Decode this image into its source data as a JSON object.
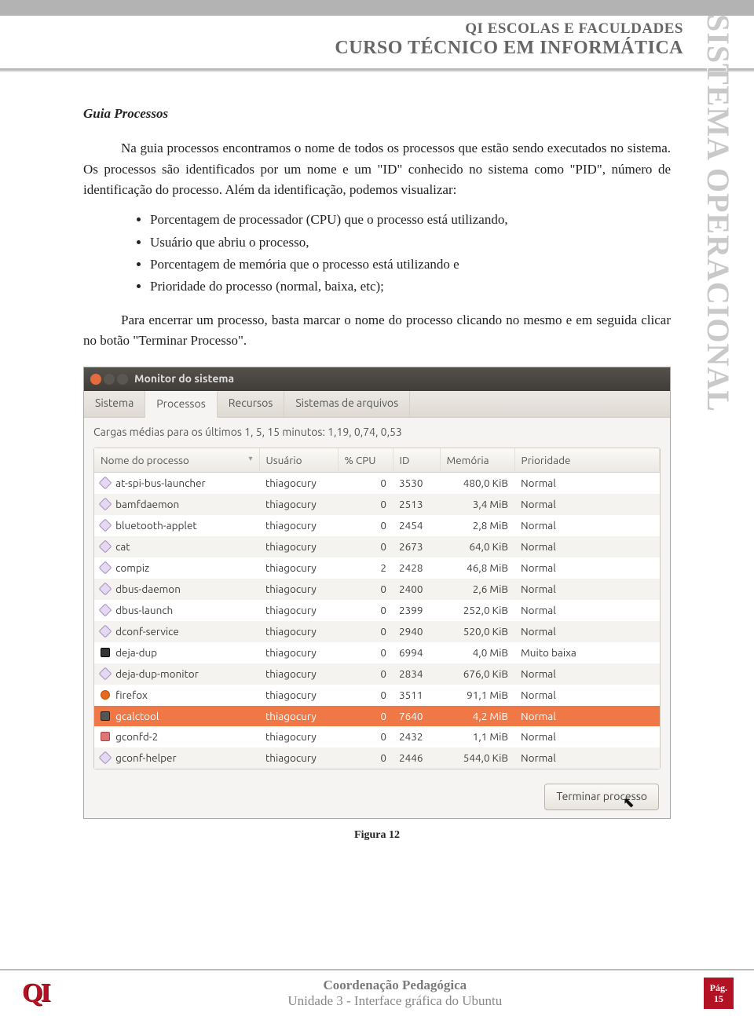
{
  "header": {
    "line1": "QI ESCOLAS E FACULDADES",
    "line2": "CURSO TÉCNICO EM INFORMÁTICA"
  },
  "side_label": "SISTEMA OPERACIONAL",
  "section_title": "Guia Processos",
  "paragraph1": "Na guia processos encontramos o nome de todos os processos que estão sendo executados no sistema. Os processos são identificados por um nome e um \"ID\" conhecido no sistema como \"PID\", número de identificação do processo. Além da identificação, podemos visualizar:",
  "bullets": [
    "Porcentagem de processador (CPU) que o processo está utilizando,",
    "Usuário que abriu o processo,",
    "Porcentagem de memória que o processo está utilizando e",
    "Prioridade do processo (normal, baixa, etc);"
  ],
  "paragraph2": "Para encerrar um processo, basta marcar o nome do processo clicando no mesmo e em seguida clicar no botão \"Terminar Processo\".",
  "screenshot": {
    "window_title": "Monitor do sistema",
    "tabs": [
      "Sistema",
      "Processos",
      "Recursos",
      "Sistemas de arquivos"
    ],
    "active_tab_index": 1,
    "loads_text": "Cargas médias para os últimos 1, 5, 15 minutos: 1,19, 0,74, 0,53",
    "columns": [
      "Nome do processo",
      "Usuário",
      "% CPU",
      "ID",
      "Memória",
      "Prioridade"
    ],
    "rows": [
      {
        "name": "at-spi-bus-launcher",
        "user": "thiagocury",
        "cpu": "0",
        "id": "3530",
        "mem": "480,0 KiB",
        "pri": "Normal",
        "icon": "diamond"
      },
      {
        "name": "bamfdaemon",
        "user": "thiagocury",
        "cpu": "0",
        "id": "2513",
        "mem": "3,4 MiB",
        "pri": "Normal",
        "icon": "diamond"
      },
      {
        "name": "bluetooth-applet",
        "user": "thiagocury",
        "cpu": "0",
        "id": "2454",
        "mem": "2,8 MiB",
        "pri": "Normal",
        "icon": "diamond"
      },
      {
        "name": "cat",
        "user": "thiagocury",
        "cpu": "0",
        "id": "2673",
        "mem": "64,0 KiB",
        "pri": "Normal",
        "icon": "diamond"
      },
      {
        "name": "compiz",
        "user": "thiagocury",
        "cpu": "2",
        "id": "2428",
        "mem": "46,8 MiB",
        "pri": "Normal",
        "icon": "diamond"
      },
      {
        "name": "dbus-daemon",
        "user": "thiagocury",
        "cpu": "0",
        "id": "2400",
        "mem": "2,6 MiB",
        "pri": "Normal",
        "icon": "diamond"
      },
      {
        "name": "dbus-launch",
        "user": "thiagocury",
        "cpu": "0",
        "id": "2399",
        "mem": "252,0 KiB",
        "pri": "Normal",
        "icon": "diamond"
      },
      {
        "name": "dconf-service",
        "user": "thiagocury",
        "cpu": "0",
        "id": "2940",
        "mem": "520,0 KiB",
        "pri": "Normal",
        "icon": "diamond"
      },
      {
        "name": "deja-dup",
        "user": "thiagocury",
        "cpu": "0",
        "id": "6994",
        "mem": "4,0 MiB",
        "pri": "Muito baixa",
        "icon": "dark"
      },
      {
        "name": "deja-dup-monitor",
        "user": "thiagocury",
        "cpu": "0",
        "id": "2834",
        "mem": "676,0 KiB",
        "pri": "Normal",
        "icon": "diamond"
      },
      {
        "name": "firefox",
        "user": "thiagocury",
        "cpu": "0",
        "id": "3511",
        "mem": "91,1 MiB",
        "pri": "Normal",
        "icon": "ff"
      },
      {
        "name": "gcalctool",
        "user": "thiagocury",
        "cpu": "0",
        "id": "7640",
        "mem": "4,2 MiB",
        "pri": "Normal",
        "icon": "calc",
        "selected": true
      },
      {
        "name": "gconfd-2",
        "user": "thiagocury",
        "cpu": "0",
        "id": "2432",
        "mem": "1,1 MiB",
        "pri": "Normal",
        "icon": "gconf"
      },
      {
        "name": "gconf-helper",
        "user": "thiagocury",
        "cpu": "0",
        "id": "2446",
        "mem": "544,0 KiB",
        "pri": "Normal",
        "icon": "diamond"
      }
    ],
    "terminate_button": "Terminar processo"
  },
  "figure_caption": "Figura 12",
  "footer": {
    "line1": "Coordenação Pedagógica",
    "line2": "Unidade 3 - Interface gráfica do Ubuntu",
    "page_label": "Pág.",
    "page_num": "15"
  }
}
